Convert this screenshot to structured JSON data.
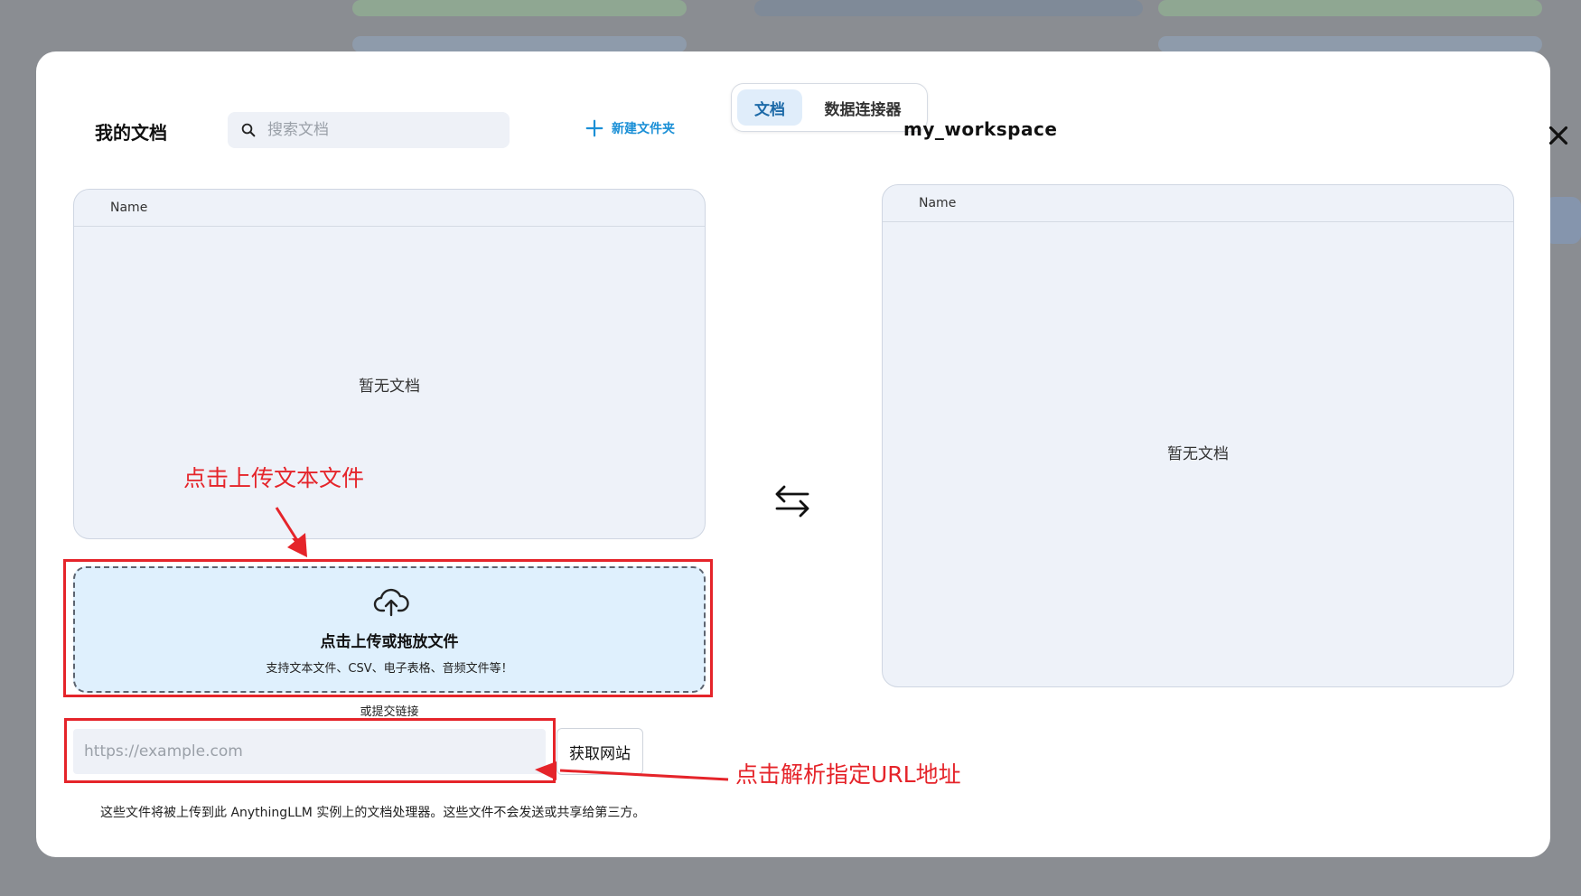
{
  "tabs": [
    {
      "label": "文档",
      "active": true
    },
    {
      "label": "数据连接器",
      "active": false
    }
  ],
  "left": {
    "title": "我的文档",
    "search_placeholder": "搜索文档",
    "new_folder_label": "新建文件夹",
    "column_name": "Name",
    "empty_text": "暂无文档"
  },
  "right": {
    "title": "my_workspace",
    "column_name": "Name",
    "empty_text": "暂无文档"
  },
  "upload": {
    "title": "点击上传或拖放文件",
    "subtitle": "支持文本文件、CSV、电子表格、音频文件等！"
  },
  "url": {
    "or_text": "或提交链接",
    "placeholder": "https://example.com",
    "fetch_label": "获取网站"
  },
  "footnote": "这些文件将被上传到此 AnythingLLM 实例上的文档处理器。这些文件不会发送或共享给第三方。",
  "annotations": {
    "upload_hint": "点击上传文本文件",
    "url_hint": "点击解析指定URL地址",
    "color": "#e5242a"
  },
  "icons": {
    "close": "close-icon",
    "search": "search-icon",
    "plus": "plus-icon",
    "swap": "swap-arrows-icon",
    "upload": "cloud-upload-icon"
  },
  "colors": {
    "accent": "#1a8fd6",
    "tab_active_bg": "#e0edfa",
    "upload_bg": "#dff0fd",
    "panel_bg": "#eef2f9"
  }
}
